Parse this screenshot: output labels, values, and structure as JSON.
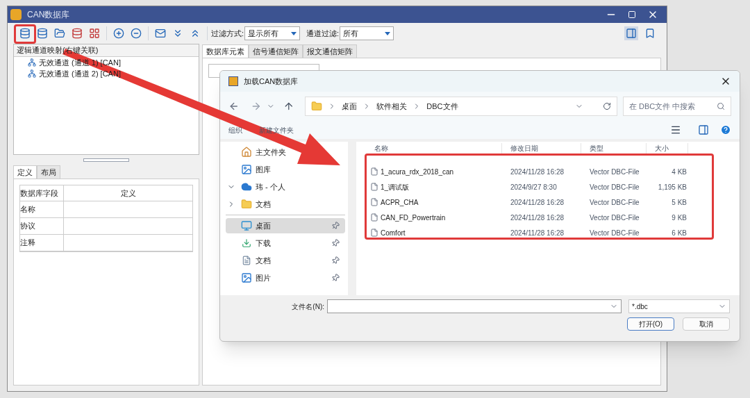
{
  "window": {
    "title": "CAN数据库"
  },
  "toolbar": {
    "filter_label": "过滤方式:",
    "filter_value": "显示所有",
    "channel_label": "通道过滤:",
    "channel_value": "所有"
  },
  "left_panel": {
    "header": "逻辑通道映射(右键关联)",
    "tree": [
      {
        "label": "无效通道 (通道 1) [CAN]"
      },
      {
        "label": "无效通道 (通道 2) [CAN]"
      }
    ],
    "tabs": [
      {
        "label": "定义",
        "selected": true
      },
      {
        "label": "布局",
        "selected": false
      }
    ],
    "table": {
      "columns": [
        "数据库字段",
        "定义"
      ],
      "rows": [
        [
          "名称",
          ""
        ],
        [
          "协议",
          ""
        ],
        [
          "注释",
          ""
        ]
      ]
    }
  },
  "right_panel": {
    "tabs": [
      {
        "label": "数据库元素",
        "selected": true
      },
      {
        "label": "信号通信矩阵",
        "selected": false
      },
      {
        "label": "报文通信矩阵",
        "selected": false
      }
    ]
  },
  "dialog": {
    "title": "加载CAN数据库",
    "breadcrumb": [
      "桌面",
      "软件相关",
      "DBC文件"
    ],
    "search_placeholder": "在 DBC文件 中搜索",
    "commands": [
      "组织",
      "新建文件夹"
    ],
    "nav": [
      {
        "label": "主文件夹",
        "kind": "home",
        "selected": false,
        "pinned": false
      },
      {
        "label": "图库",
        "kind": "gallery",
        "selected": false,
        "pinned": false
      },
      {
        "label": "玮 - 个人",
        "kind": "cloud",
        "selected": false,
        "pinned": false,
        "expanded": true,
        "children": [
          {
            "label": "文档",
            "kind": "folder",
            "selected": false,
            "pinned": false,
            "expanded": false
          }
        ]
      },
      {
        "label": "桌面",
        "kind": "desktop",
        "selected": true,
        "pinned": true,
        "divider": true
      },
      {
        "label": "下载",
        "kind": "download",
        "selected": false,
        "pinned": true
      },
      {
        "label": "文档",
        "kind": "document",
        "selected": false,
        "pinned": true
      },
      {
        "label": "图片",
        "kind": "picture",
        "selected": false,
        "pinned": true
      }
    ],
    "columns": [
      "名称",
      "修改日期",
      "类型",
      "大小"
    ],
    "files": [
      {
        "name": "1_acura_rdx_2018_can",
        "date": "2024/11/28 16:28",
        "type": "Vector DBC-File",
        "size": "4 KB"
      },
      {
        "name": "1_调试版",
        "date": "2024/9/27 8:30",
        "type": "Vector DBC-File",
        "size": "1,195 KB"
      },
      {
        "name": "ACPR_CHA",
        "date": "2024/11/28 16:28",
        "type": "Vector DBC-File",
        "size": "5 KB"
      },
      {
        "name": "CAN_FD_Powertrain",
        "date": "2024/11/28 16:28",
        "type": "Vector DBC-File",
        "size": "9 KB"
      },
      {
        "name": "Comfort",
        "date": "2024/11/28 16:28",
        "type": "Vector DBC-File",
        "size": "6 KB"
      }
    ],
    "filename_label": "文件名(N):",
    "filetype": "*.dbc",
    "buttons": [
      {
        "label": "打开(O)",
        "default": true
      },
      {
        "label": "取消",
        "default": false
      }
    ]
  }
}
